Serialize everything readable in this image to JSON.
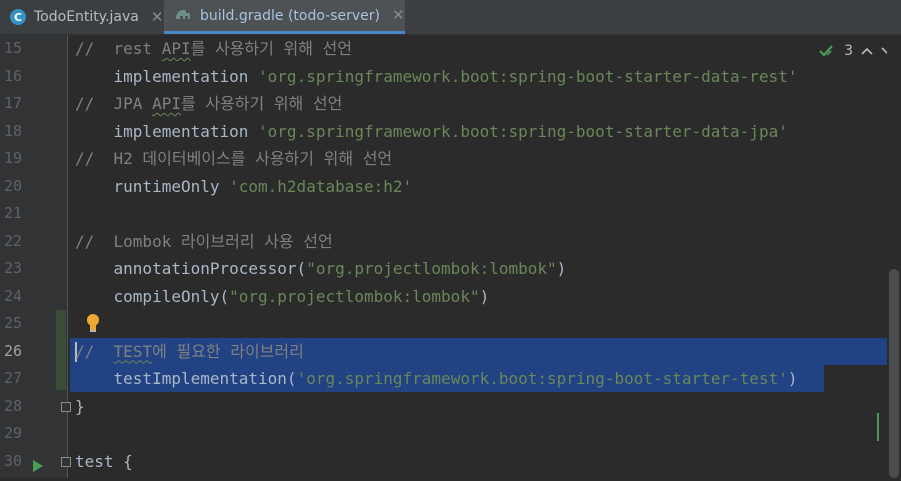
{
  "tabs": [
    {
      "icon": "java-class-icon",
      "label": "TodoEntity.java",
      "active": false
    },
    {
      "icon": "gradle-icon",
      "label": "build.gradle (todo-server)",
      "active": true
    }
  ],
  "inspection": {
    "count": "3"
  },
  "lines": [
    {
      "num": "15",
      "text": "//  rest API를 사용하기 위해 선언"
    },
    {
      "num": "16",
      "text": "    implementation 'org.springframework.boot:spring-boot-starter-data-rest'"
    },
    {
      "num": "17",
      "text": "//  JPA API를 사용하기 위해 선언"
    },
    {
      "num": "18",
      "text": "    implementation 'org.springframework.boot:spring-boot-starter-data-jpa'"
    },
    {
      "num": "19",
      "text": "//  H2 데이터베이스를 사용하기 위해 선언"
    },
    {
      "num": "20",
      "text": "    runtimeOnly 'com.h2database:h2'"
    },
    {
      "num": "21",
      "text": ""
    },
    {
      "num": "22",
      "text": "//  Lombok 라이브러리 사용 선언"
    },
    {
      "num": "23",
      "text": "    annotationProcessor(\"org.projectlombok:lombok\")"
    },
    {
      "num": "24",
      "text": "    compileOnly(\"org.projectlombok:lombok\")"
    },
    {
      "num": "25",
      "text": ""
    },
    {
      "num": "26",
      "text": "//  TEST에 필요한 라이브러리"
    },
    {
      "num": "27",
      "text": "    testImplementation('org.springframework.boot:spring-boot-starter-test')"
    },
    {
      "num": "28",
      "text": "}"
    },
    {
      "num": "29",
      "text": ""
    },
    {
      "num": "30",
      "text": "test {"
    }
  ],
  "segments": {
    "l15": {
      "a": "//  rest ",
      "b": "API",
      "c": "를 사용하기 위해 선언"
    },
    "l16": {
      "a": "    implementation ",
      "b": "'org.springframework.boot:spring-boot-starter-data-rest'"
    },
    "l17": {
      "a": "//  JPA ",
      "b": "API",
      "c": "를 사용하기 위해 선언"
    },
    "l18": {
      "a": "    implementation ",
      "b": "'org.springframework.boot:spring-boot-starter-data-jpa'"
    },
    "l19": {
      "a": "//  H2 데이터베이스를 사용하기 위해 선언"
    },
    "l20": {
      "a": "    runtimeOnly ",
      "b": "'com.h2database:h2'"
    },
    "l22": {
      "a": "//  Lombok 라이브러리 사용 선언"
    },
    "l23": {
      "a": "    annotationProcessor(",
      "b": "\"org.projectlombok:lombok\"",
      "c": ")"
    },
    "l24": {
      "a": "    compileOnly(",
      "b": "\"org.projectlombok:lombok\"",
      "c": ")"
    },
    "l26": {
      "a": "/",
      "b": "/  ",
      "c": "TEST",
      "d": "에 필요한 라이브러리"
    },
    "l27": {
      "a": "    testImplementation(",
      "b": "'org.springframework.boot:spring-boot-starter-test'",
      "c": ")"
    },
    "l28": {
      "a": "}"
    },
    "l30": {
      "a": "test {"
    }
  },
  "colors": {
    "background": "#2b2b2b",
    "gutter": "#313335",
    "comment": "#808080",
    "string": "#6a8759",
    "selection": "#214283",
    "tab_active_underline": "#4a88c7"
  }
}
